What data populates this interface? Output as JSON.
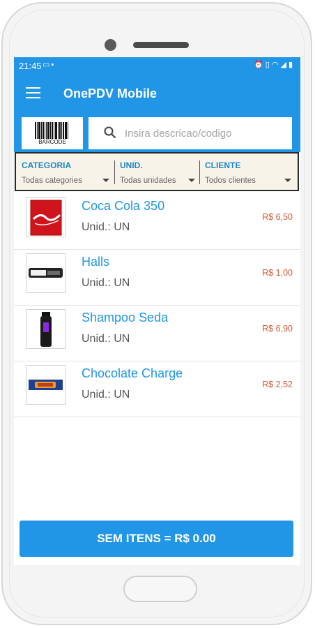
{
  "status_bar": {
    "time": "21:45",
    "left_icons": [
      "laptop-icon",
      "sim-icon"
    ],
    "right_icons": [
      "alarm-icon",
      "vibrate-icon",
      "wifi-icon",
      "signal-icon",
      "battery-icon"
    ]
  },
  "app_bar": {
    "title": "OnePDV Mobile",
    "menu_icon": "hamburger-menu-icon"
  },
  "search": {
    "barcode_label": "BARCODE",
    "placeholder": "Insira descricao/codigo",
    "value": ""
  },
  "filters": [
    {
      "label": "CATEGORIA",
      "value": "Todas categories"
    },
    {
      "label": "UNID.",
      "value": "Todas unidades"
    },
    {
      "label": "CLIENTE",
      "value": "Todos clientes"
    }
  ],
  "products": [
    {
      "name": "Coca Cola 350",
      "unit": "Unid.: UN",
      "price": "R$ 6,50"
    },
    {
      "name": "Halls",
      "unit": "Unid.: UN",
      "price": "R$ 1,00"
    },
    {
      "name": "Shampoo Seda",
      "unit": "Unid.: UN",
      "price": "R$ 6,90"
    },
    {
      "name": "Chocolate Charge",
      "unit": "Unid.: UN",
      "price": "R$ 2,52"
    }
  ],
  "footer": {
    "label": "SEM ITENS = R$ 0.00"
  },
  "colors": {
    "primary": "#2196e6",
    "price": "#d35a34",
    "filter_bg": "#f7f3e8",
    "filter_label": "#1e88c7"
  }
}
